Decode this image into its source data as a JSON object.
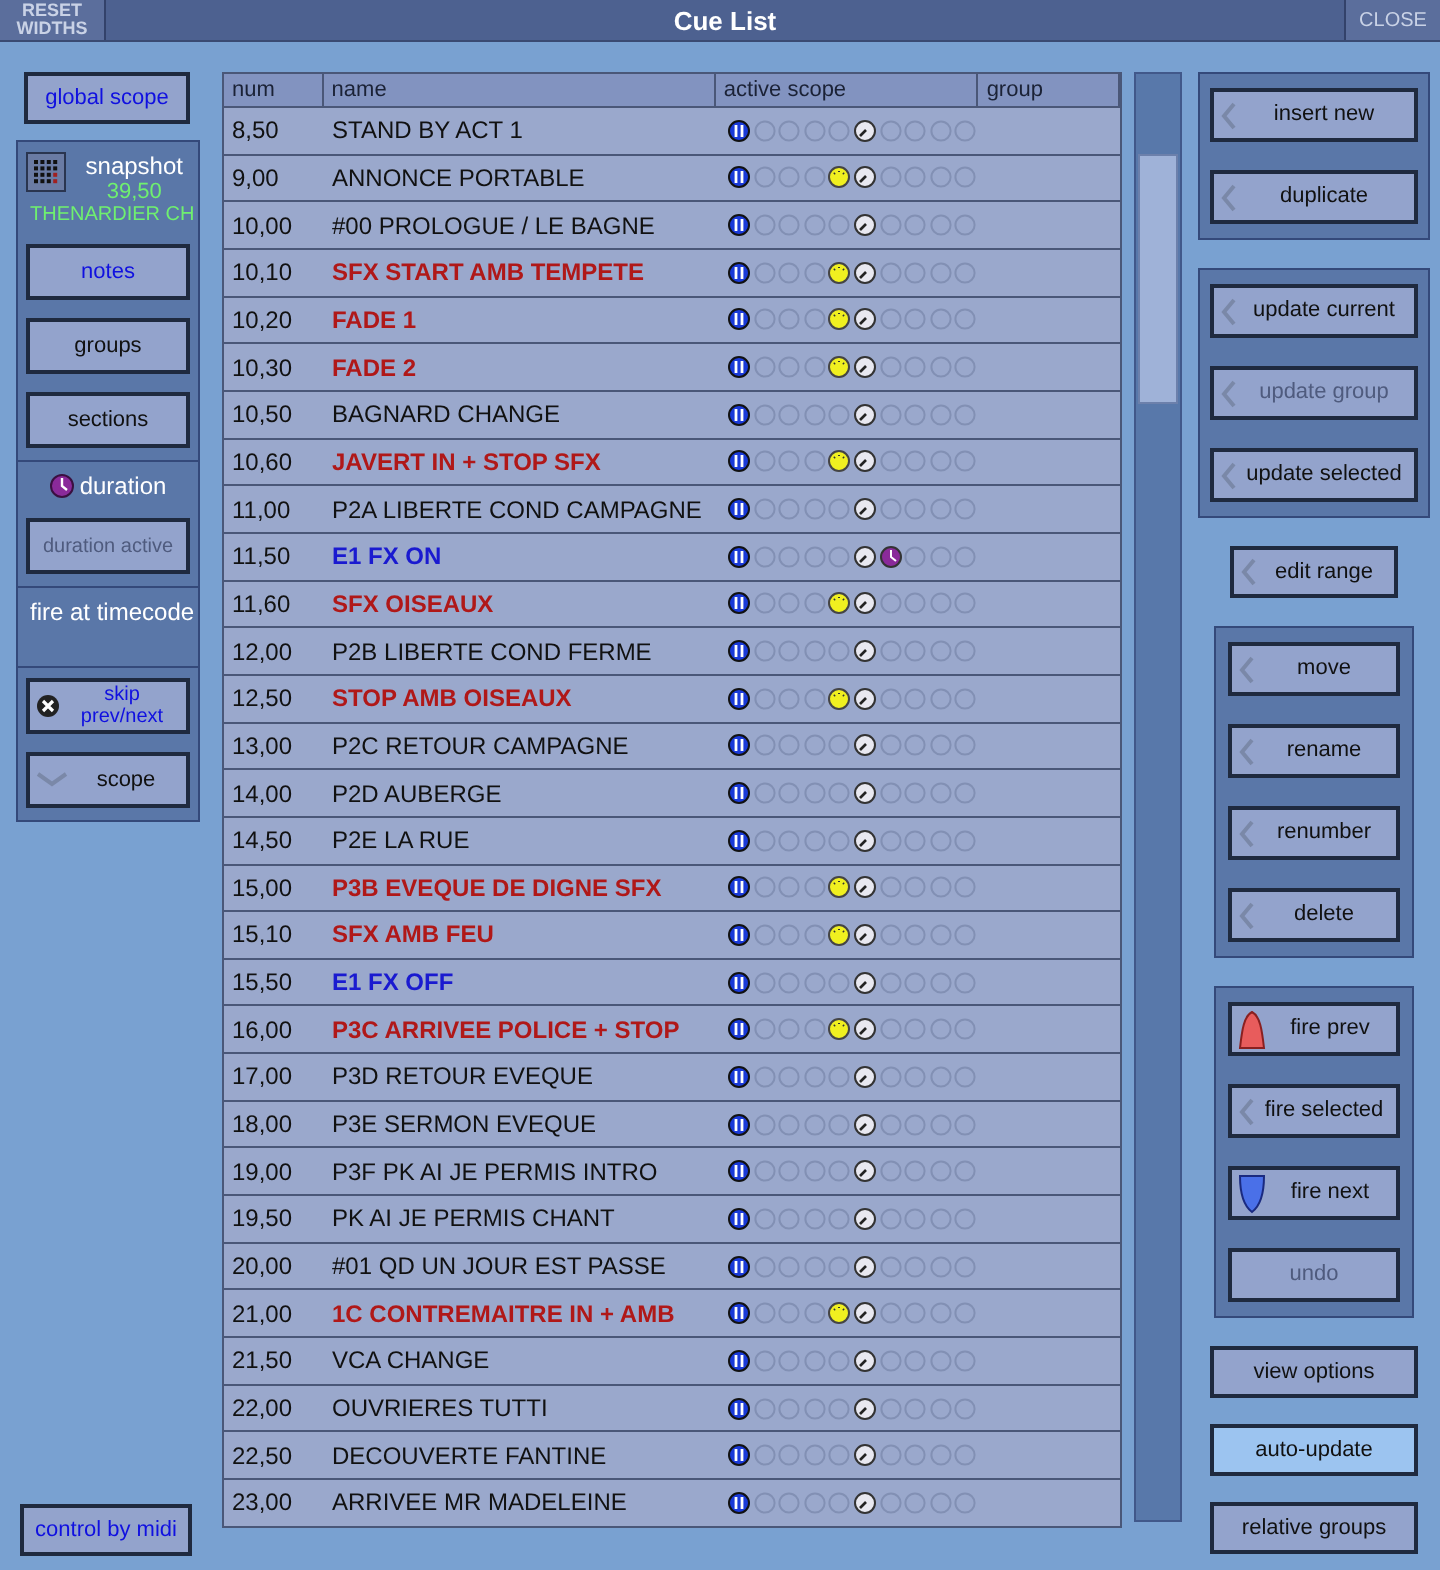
{
  "title_bar": {
    "reset_button": "RESET WIDTHS",
    "title": "Cue List",
    "close_button": "CLOSE"
  },
  "left_panel": {
    "global_scope": {
      "label": "global scope",
      "active": true
    },
    "sections": [
      [
        {
          "kind": "snapshot",
          "label": "snapshot",
          "number": "39,50",
          "name": "THENARDIER CH"
        },
        {
          "kind": "button",
          "label": "notes",
          "active": true,
          "disabled": false
        },
        {
          "kind": "button",
          "label": "groups",
          "active": false,
          "disabled": false
        },
        {
          "kind": "button",
          "label": "sections",
          "active": false,
          "disabled": false
        }
      ],
      [
        {
          "kind": "toggle",
          "label": "duration"
        },
        {
          "kind": "button",
          "label": "duration active",
          "disabled": true
        }
      ],
      [
        {
          "kind": "label",
          "label": "fire at timecode"
        }
      ],
      [
        {
          "kind": "skip",
          "label": "skip prev/next",
          "active": true,
          "disabled": false
        },
        {
          "kind": "dropdown",
          "label": "scope",
          "active": false,
          "disabled": false
        }
      ]
    ],
    "midi": {
      "label": "control by midi",
      "active": true
    }
  },
  "table": {
    "columns": [
      "num",
      "name",
      "active scope",
      "group"
    ],
    "rows": [
      {
        "num": "8,50",
        "name": "STAND BY ACT 1",
        "kind": "normal",
        "recall": false,
        "duration": false
      },
      {
        "num": "9,00",
        "name": "ANNONCE PORTABLE",
        "kind": "normal",
        "recall": true,
        "duration": false
      },
      {
        "num": "10,00",
        "name": "#00 PROLOGUE / LE BAGNE",
        "kind": "normal",
        "recall": false,
        "duration": false
      },
      {
        "num": "10,10",
        "name": "SFX START AMB TEMPETE",
        "kind": "red",
        "recall": true,
        "duration": false
      },
      {
        "num": "10,20",
        "name": "FADE 1",
        "kind": "red",
        "recall": true,
        "duration": false
      },
      {
        "num": "10,30",
        "name": "FADE 2",
        "kind": "red",
        "recall": true,
        "duration": false
      },
      {
        "num": "10,50",
        "name": "BAGNARD CHANGE",
        "kind": "normal",
        "recall": false,
        "duration": false
      },
      {
        "num": "10,60",
        "name": "JAVERT IN + STOP SFX",
        "kind": "red",
        "recall": true,
        "duration": false
      },
      {
        "num": "11,00",
        "name": "P2A LIBERTE COND CAMPAGNE",
        "kind": "normal",
        "recall": false,
        "duration": false
      },
      {
        "num": "11,50",
        "name": "E1 FX ON",
        "kind": "blue",
        "recall": false,
        "duration": true
      },
      {
        "num": "11,60",
        "name": "SFX OISEAUX",
        "kind": "red",
        "recall": true,
        "duration": false
      },
      {
        "num": "12,00",
        "name": "P2B LIBERTE COND FERME",
        "kind": "normal",
        "recall": false,
        "duration": false
      },
      {
        "num": "12,50",
        "name": "STOP AMB OISEAUX",
        "kind": "red",
        "recall": true,
        "duration": false
      },
      {
        "num": "13,00",
        "name": "P2C RETOUR CAMPAGNE",
        "kind": "normal",
        "recall": false,
        "duration": false
      },
      {
        "num": "14,00",
        "name": "P2D AUBERGE",
        "kind": "normal",
        "recall": false,
        "duration": false
      },
      {
        "num": "14,50",
        "name": "P2E LA RUE",
        "kind": "normal",
        "recall": false,
        "duration": false
      },
      {
        "num": "15,00",
        "name": "P3B EVEQUE DE DIGNE SFX",
        "kind": "red",
        "recall": true,
        "duration": false
      },
      {
        "num": "15,10",
        "name": "SFX AMB FEU",
        "kind": "red",
        "recall": true,
        "duration": false
      },
      {
        "num": "15,50",
        "name": "E1 FX OFF",
        "kind": "blue",
        "recall": false,
        "duration": false
      },
      {
        "num": "16,00",
        "name": "P3C ARRIVEE POLICE + STOP",
        "kind": "red",
        "recall": true,
        "duration": false
      },
      {
        "num": "17,00",
        "name": "P3D RETOUR EVEQUE",
        "kind": "normal",
        "recall": false,
        "duration": false
      },
      {
        "num": "18,00",
        "name": "P3E SERMON EVEQUE",
        "kind": "normal",
        "recall": false,
        "duration": false
      },
      {
        "num": "19,00",
        "name": "P3F PK AI JE PERMIS INTRO",
        "kind": "normal",
        "recall": false,
        "duration": false
      },
      {
        "num": "19,50",
        "name": "PK AI JE PERMIS CHANT",
        "kind": "normal",
        "recall": false,
        "duration": false
      },
      {
        "num": "20,00",
        "name": "#01 QD UN JOUR EST PASSE",
        "kind": "normal",
        "recall": false,
        "duration": false
      },
      {
        "num": "21,00",
        "name": "1C CONTREMAITRE IN + AMB",
        "kind": "red",
        "recall": true,
        "duration": false
      },
      {
        "num": "21,50",
        "name": "VCA CHANGE",
        "kind": "normal",
        "recall": false,
        "duration": false
      },
      {
        "num": "22,00",
        "name": "OUVRIERES TUTTI",
        "kind": "normal",
        "recall": false,
        "duration": false
      },
      {
        "num": "22,50",
        "name": "DECOUVERTE FANTINE",
        "kind": "normal",
        "recall": false,
        "duration": false
      },
      {
        "num": "23,00",
        "name": "ARRIVEE MR MADELEINE",
        "kind": "normal",
        "recall": false,
        "duration": false
      }
    ]
  },
  "right_panel": [
    {
      "framed": true,
      "buttons": [
        {
          "label": "insert new",
          "kind": "action",
          "disabled": false
        },
        {
          "label": "duplicate",
          "kind": "action",
          "disabled": false
        }
      ]
    },
    {
      "framed": true,
      "buttons": [
        {
          "label": "update current",
          "kind": "action",
          "disabled": false
        },
        {
          "label": "update group",
          "kind": "action",
          "disabled": true
        },
        {
          "label": "update selected",
          "kind": "action",
          "disabled": false
        }
      ]
    },
    {
      "framed": false,
      "buttons": [
        {
          "label": "edit range",
          "kind": "action",
          "disabled": false
        }
      ]
    },
    {
      "framed": true,
      "buttons": [
        {
          "label": "move",
          "kind": "action",
          "disabled": false
        },
        {
          "label": "rename",
          "kind": "action",
          "disabled": false
        },
        {
          "label": "renumber",
          "kind": "action",
          "disabled": false
        },
        {
          "label": "delete",
          "kind": "action",
          "disabled": false
        }
      ]
    },
    {
      "framed": true,
      "buttons": [
        {
          "label": "fire prev",
          "kind": "fire-prev",
          "disabled": false
        },
        {
          "label": "fire selected",
          "kind": "action",
          "disabled": false
        },
        {
          "label": "fire next",
          "kind": "fire-next",
          "disabled": false
        },
        {
          "label": "undo",
          "kind": "plain",
          "disabled": true
        }
      ]
    },
    {
      "framed": false,
      "buttons": [
        {
          "label": "view options",
          "kind": "plain",
          "on": false
        },
        {
          "label": "auto-update",
          "kind": "plain",
          "on": true
        },
        {
          "label": "relative groups",
          "kind": "plain",
          "on": false
        }
      ]
    }
  ]
}
